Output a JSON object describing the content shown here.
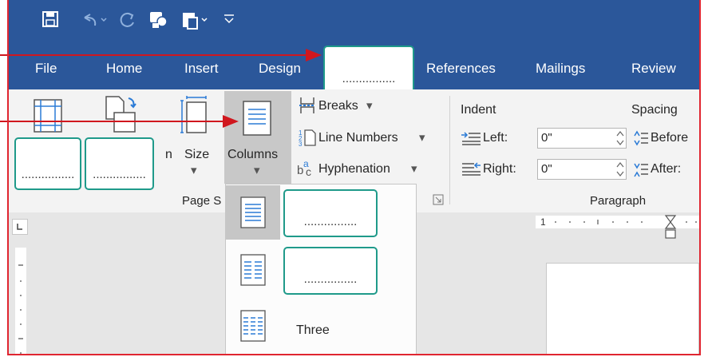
{
  "qat": {
    "icons": [
      "save-icon",
      "undo-icon",
      "redo-icon",
      "touch-mode-icon",
      "paste-icon",
      "customize-icon"
    ]
  },
  "tabs": [
    {
      "label": "File"
    },
    {
      "label": "Home"
    },
    {
      "label": "Insert"
    },
    {
      "label": "Design"
    },
    {
      "label": "................"
    },
    {
      "label": "References"
    },
    {
      "label": "Mailings"
    },
    {
      "label": "Review"
    }
  ],
  "ribbon": {
    "size_label": "Size",
    "partial_label": "n",
    "columns_label": "Columns",
    "breaks_label": "Breaks",
    "line_numbers_label": "Line Numbers",
    "hyphenation_label": "Hyphenation",
    "group_page_setup": "Page S",
    "indent_label": "Indent",
    "spacing_label": "Spacing",
    "left_label": "Left:",
    "right_label": "Right:",
    "left_value": "0\"",
    "right_value": "0\"",
    "before_label": "Before",
    "after_label": "After:",
    "paragraph_group": "Paragraph",
    "blank_1": "................",
    "blank_2": "................"
  },
  "columns_menu": {
    "items": [
      {
        "label": "................"
      },
      {
        "label": "................"
      },
      {
        "label": "Three"
      }
    ]
  },
  "ruler": {
    "start_number": "1"
  },
  "colors": {
    "title_blue": "#2b579a",
    "teal_outline": "#1f9a8a",
    "arrow_red": "#d0171e",
    "frame_red": "#e02530"
  }
}
